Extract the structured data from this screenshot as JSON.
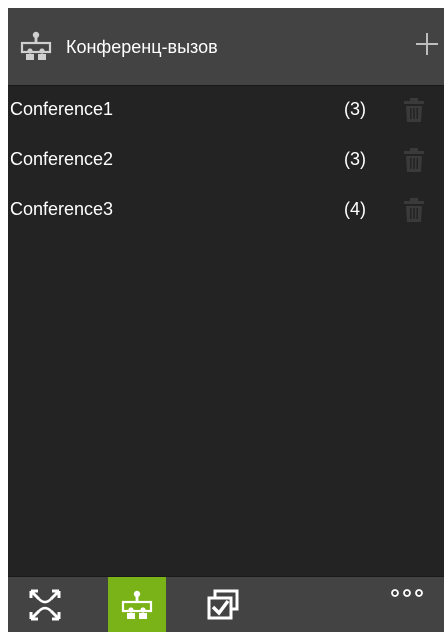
{
  "header": {
    "title": "Конференц-вызов",
    "icon": "conference-icon",
    "add_icon": "plus-icon"
  },
  "conferences": [
    {
      "name": "Conference1",
      "count": "(3)"
    },
    {
      "name": "Conference2",
      "count": "(3)"
    },
    {
      "name": "Conference3",
      "count": "(4)"
    }
  ],
  "footer": {
    "buttons": [
      {
        "icon": "fit-screen-icon",
        "active": false
      },
      {
        "icon": "conference-icon",
        "active": true
      },
      {
        "icon": "checklist-icon",
        "active": false
      },
      {
        "icon": "more-icon",
        "active": false
      }
    ]
  },
  "colors": {
    "accent": "#7ab317",
    "background": "#232323",
    "bar": "#434343",
    "text": "#ffffff",
    "trash": "#3a3a3a"
  }
}
